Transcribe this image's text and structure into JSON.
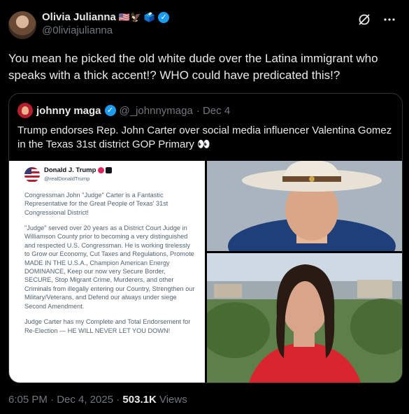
{
  "author": {
    "name": "Olivia Julianna",
    "emoji": "🇺🇸🦅 🗳️",
    "handle": "@0liviajulianna"
  },
  "tweet": {
    "text": "You mean he picked the old white dude over the Latina immigrant who speaks with a thick accent!? WHO could have predicated this!?"
  },
  "quote": {
    "name": "johnny maga",
    "handle": "@_johnnymaga",
    "date": "· Dec 4",
    "text": "Trump endorses Rep. John Carter over social media influencer Valentina Gomez in the Texas 31st district GOP Primary 👀"
  },
  "truth_post": {
    "name": "Donald J. Trump",
    "handle": "@realDonaldTrump",
    "paragraphs": [
      "Congressman John \"Judge\" Carter is a Fantastic Representative for the Great People of Texas' 31st Congressional District!",
      "\"Judge\" served over 20 years as a District Court Judge in Williamson County prior to becoming a very distinguished and respected U.S. Congressman. He is working tirelessly to Grow our Economy, Cut Taxes and Regulations, Promote MADE IN THE U.S.A., Champion American Energy DOMINANCE, Keep our now very Secure Border, SECURE, Stop Migrant Crime, Murderers, and other Criminals from illegally entering our Country, Strengthen our Military/Veterans, and Defend our always under siege Second Amendment.",
      "Judge Carter has my Complete and Total Endorsement for Re-Election — HE WILL NEVER LET YOU DOWN!"
    ]
  },
  "footer": {
    "time": "6:05 PM · Dec 4, 2025 · ",
    "views_count": "503.1K",
    "views_label": " Views"
  },
  "colors": {
    "background": "#000000",
    "text": "#e7e9ea",
    "muted": "#71767b",
    "verified": "#1d9bf0",
    "border": "#2f3336"
  },
  "icons": [
    "verified-badge-icon",
    "grok-icon",
    "more-icon"
  ]
}
